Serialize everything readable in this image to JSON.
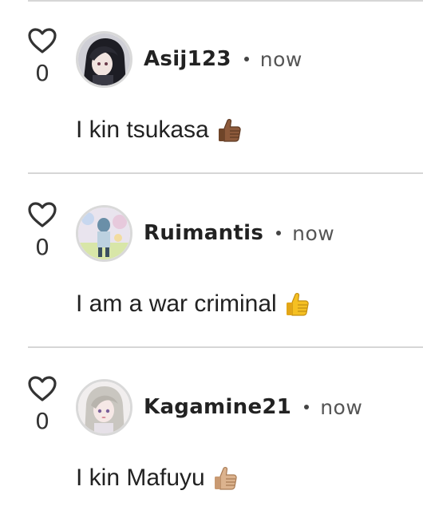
{
  "comments": [
    {
      "username": "Asij123",
      "time": "now",
      "text": "I kin tsukasa",
      "likes": "0",
      "avatar_icon": "avatar-dark-hair",
      "emoji_icon": "thumbs-up-medium-dark",
      "thumb_color": "#8d5a3b"
    },
    {
      "username": "Ruimantis",
      "time": "now",
      "text": "I am a war criminal",
      "likes": "0",
      "avatar_icon": "avatar-pastel-figure",
      "emoji_icon": "thumbs-up-yellow",
      "thumb_color": "#f5c022"
    },
    {
      "username": "Kagamine21",
      "time": "now",
      "text": "I kin Mafuyu",
      "likes": "0",
      "avatar_icon": "avatar-silver-hair",
      "emoji_icon": "thumbs-up-medium-light",
      "thumb_color": "#dcb38e"
    }
  ]
}
